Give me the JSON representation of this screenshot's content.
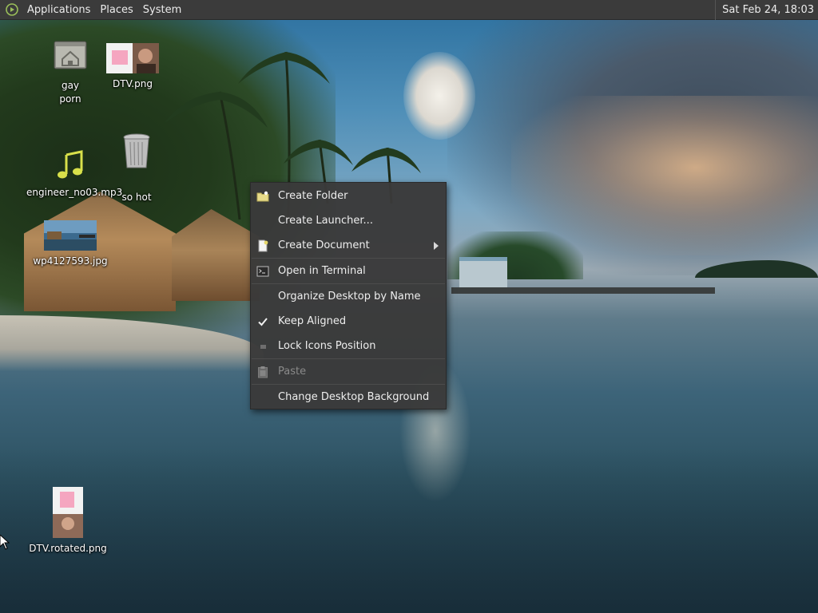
{
  "panel": {
    "menus": [
      "Applications",
      "Places",
      "System"
    ],
    "clock": "Sat Feb 24, 18:03"
  },
  "desktop_icons": [
    {
      "label_line1": "gay",
      "label_line2": "porn",
      "icon": "home-folder-icon"
    },
    {
      "label": "DTV.png",
      "icon": "image-thumbnail-icon"
    },
    {
      "label": "engineer_no03.mp3",
      "icon": "music-note-icon"
    },
    {
      "label": "so hot",
      "icon": "trash-icon"
    },
    {
      "label": "wp4127593.jpg",
      "icon": "image-thumbnail-icon"
    },
    {
      "label": "DTV.rotated.png",
      "icon": "image-thumbnail-icon"
    }
  ],
  "context_menu": {
    "items": [
      {
        "label": "Create Folder",
        "icon": "new-folder-icon"
      },
      {
        "label": "Create Launcher...",
        "icon": ""
      },
      {
        "label": "Create Document",
        "icon": "new-document-icon",
        "submenu": true
      },
      {
        "label": "Open in Terminal",
        "icon": "terminal-icon"
      },
      {
        "label": "Organize Desktop by Name",
        "icon": ""
      },
      {
        "label": "Keep Aligned",
        "icon": "checkmark-icon",
        "checked": true
      },
      {
        "label": "Lock Icons Position",
        "icon": "lock-square-icon"
      },
      {
        "label": "Paste",
        "icon": "clipboard-icon",
        "disabled": true
      },
      {
        "label": "Change Desktop Background",
        "icon": ""
      }
    ]
  },
  "colors": {
    "panel_bg": "#3b3b3b",
    "menu_bg": "#3a3a3a",
    "menu_text": "#eeeeee",
    "menu_disabled_text": "#8a8a8a"
  }
}
